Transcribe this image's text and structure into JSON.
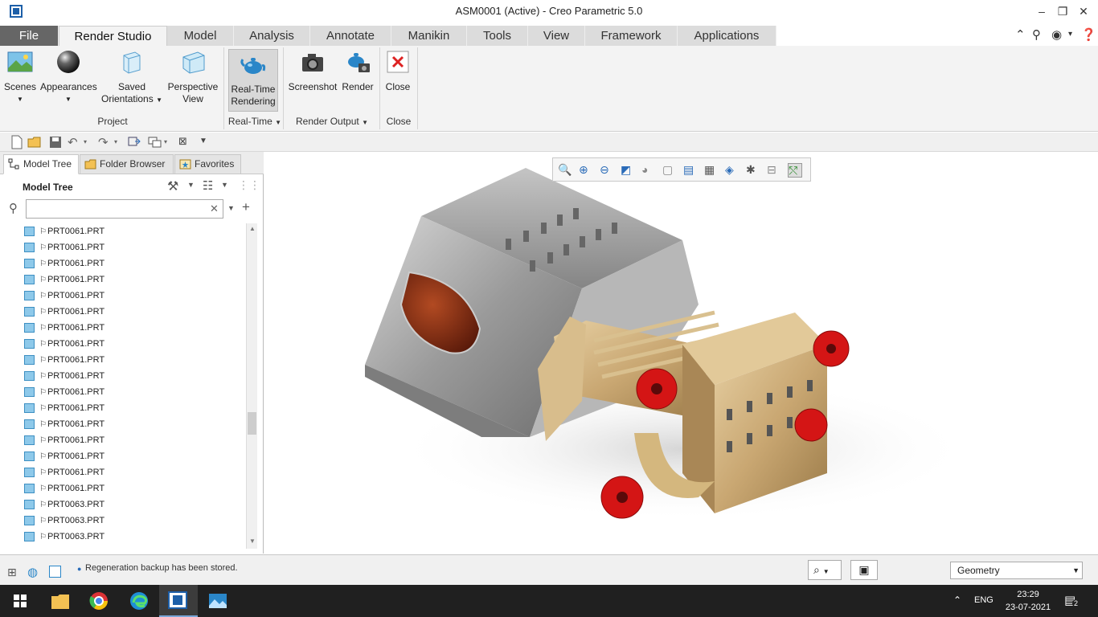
{
  "window": {
    "title": "ASM0001 (Active) - Creo Parametric 5.0"
  },
  "menu": {
    "tabs": [
      {
        "label": "File"
      },
      {
        "label": "Render Studio"
      },
      {
        "label": "Model"
      },
      {
        "label": "Analysis"
      },
      {
        "label": "Annotate"
      },
      {
        "label": "Manikin"
      },
      {
        "label": "Tools"
      },
      {
        "label": "View"
      },
      {
        "label": "Framework"
      },
      {
        "label": "Applications"
      }
    ]
  },
  "ribbon": {
    "scenes": "Scenes",
    "appearances": "Appearances",
    "saved_1": "Saved",
    "saved_2": "Orientations",
    "perspective_1": "Perspective",
    "perspective_2": "View",
    "realtime_1": "Real-Time",
    "realtime_2": "Rendering",
    "screenshot": "Screenshot",
    "render": "Render",
    "close": "Close",
    "groups": {
      "project": "Project",
      "realtime": "Real-Time",
      "render_output": "Render Output",
      "close": "Close"
    }
  },
  "panel": {
    "tabs": {
      "model_tree": "Model Tree",
      "folder_browser": "Folder Browser",
      "favorites": "Favorites"
    },
    "tree_title": "Model Tree",
    "search_value": "",
    "items": [
      "PRT0061.PRT",
      "PRT0061.PRT",
      "PRT0061.PRT",
      "PRT0061.PRT",
      "PRT0061.PRT",
      "PRT0061.PRT",
      "PRT0061.PRT",
      "PRT0061.PRT",
      "PRT0061.PRT",
      "PRT0061.PRT",
      "PRT0061.PRT",
      "PRT0061.PRT",
      "PRT0061.PRT",
      "PRT0061.PRT",
      "PRT0061.PRT",
      "PRT0061.PRT",
      "PRT0061.PRT",
      "PRT0063.PRT",
      "PRT0063.PRT",
      "PRT0063.PRT"
    ]
  },
  "status": {
    "message": "Regeneration backup has been stored.",
    "filter": "Geometry"
  },
  "taskbar": {
    "language": "ENG",
    "time": "23:29",
    "date": "23-07-2021",
    "notifications": "2"
  },
  "colors": {
    "accent": "#1d5fa8",
    "flange_red": "#d41515",
    "brass": "#c9a772"
  }
}
